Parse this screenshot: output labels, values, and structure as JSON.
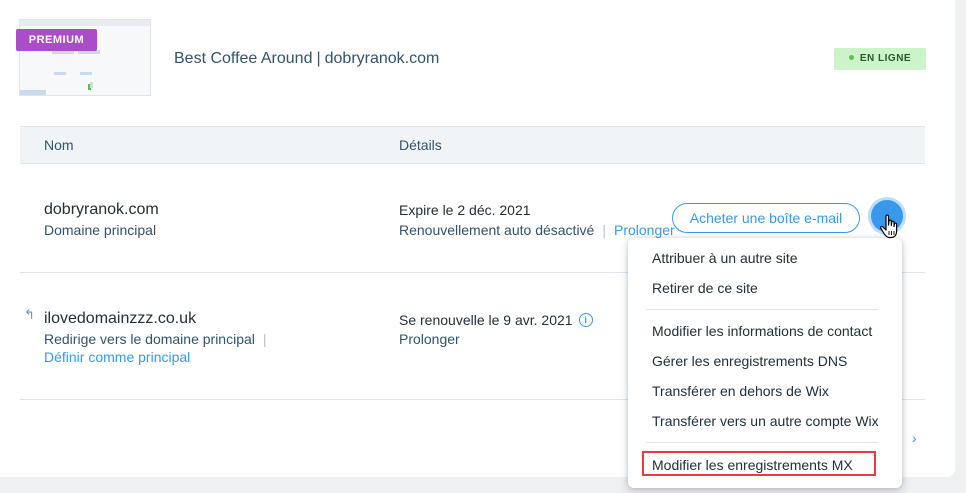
{
  "site": {
    "badge": "PREMIUM",
    "name": "Best Coffee Around",
    "separator": "|",
    "domain": "dobryranok.com",
    "status": "EN LIGNE"
  },
  "table": {
    "headers": [
      "Nom",
      "Détails"
    ],
    "rows": [
      {
        "name": "dobryranok.com",
        "sub": "Domaine principal",
        "detail1": "Expire le 2 déc. 2021",
        "detail2": "Renouvellement auto désactivé",
        "detail2_link": "Prolonger",
        "action": "Acheter une boîte e-mail"
      },
      {
        "name": "ilovedomainzzz.co.uk",
        "sub": "Redirige vers le domaine principal",
        "sub_link": "Définir comme principal",
        "detail1": "Se renouvelle le 9 avr. 2021",
        "detail2_link": "Prolonger"
      }
    ]
  },
  "menu": {
    "items": [
      "Attribuer à un autre site",
      "Retirer de ce site",
      "Modifier les informations de contact",
      "Gérer les enregistrements DNS",
      "Transférer en dehors de Wix",
      "Transférer vers un autre compte Wix",
      "Modifier les enregistrements MX"
    ],
    "highlighted_index": 6
  },
  "colors": {
    "accent": "#3899ec",
    "premium": "#aa4dc8",
    "online_bg": "#cdf3cb",
    "highlight_border": "#e83b3b"
  },
  "icons": [
    "info-icon",
    "redirect-arrow-icon",
    "hand-cursor-icon",
    "chevron-right-icon"
  ]
}
